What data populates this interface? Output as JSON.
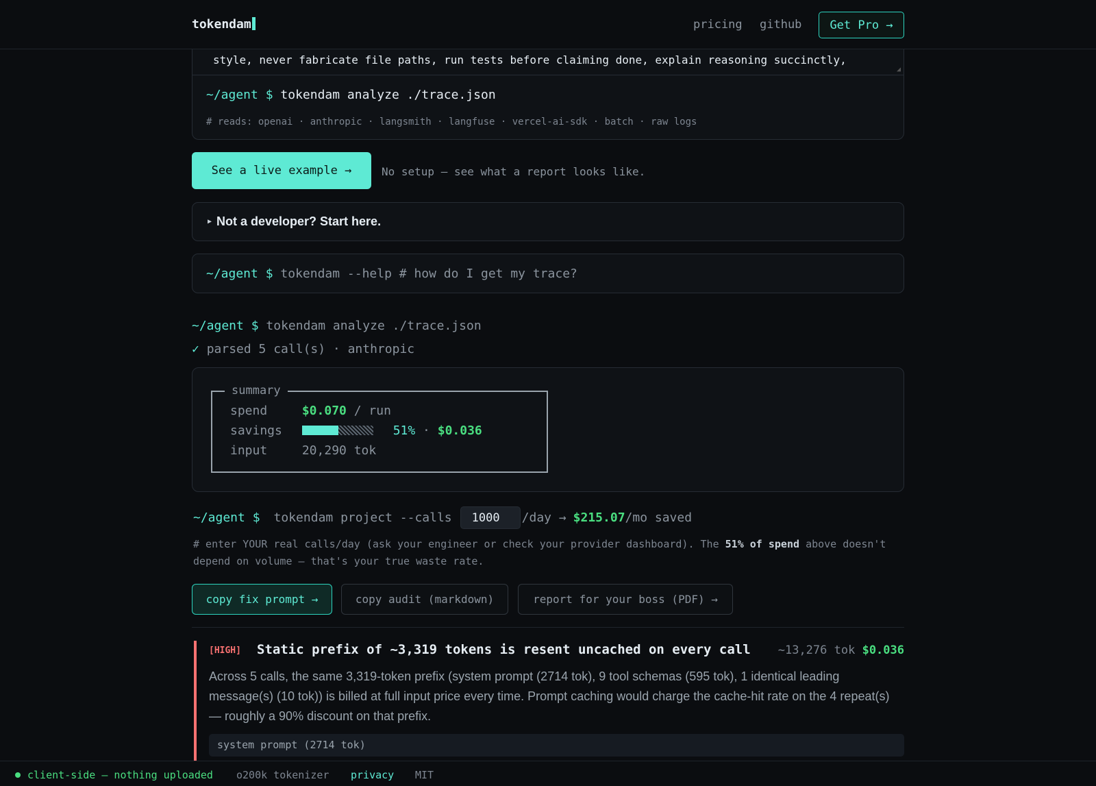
{
  "header": {
    "brand": "tokendam",
    "nav": [
      "pricing",
      "github"
    ],
    "cta": "Get Pro →"
  },
  "prompt_excerpt": "style, never fabricate file paths, run tests before claiming done, explain reasoning succinctly,",
  "analyze_box": {
    "prompt": "~/agent $",
    "command": "tokendam analyze ./trace.json",
    "reads": "# reads: openai · anthropic · langsmith · langfuse · vercel-ai-sdk · batch · raw logs"
  },
  "live": {
    "button": "See a live example →",
    "note": "No setup — see what a report looks like."
  },
  "not_developer": "Not a developer? Start here.",
  "help": {
    "prompt": "~/agent $",
    "command": "tokendam --help # how do I get my trace?"
  },
  "run": {
    "prompt": "~/agent $",
    "command": "tokendam analyze ./trace.json",
    "parsed_check": "✓",
    "parsed": "parsed 5 call(s) · anthropic"
  },
  "summary": {
    "title": "summary",
    "spend_label": "spend",
    "spend_value": "$0.070",
    "spend_unit": "/ run",
    "savings_label": "savings",
    "savings_fraction": 0.51,
    "savings_pct": "51%",
    "savings_sep": "·",
    "savings_value": "$0.036",
    "input_label": "input",
    "input_value": "20,290 tok"
  },
  "project": {
    "prompt": "~/agent $",
    "command": "tokendam project --calls",
    "calls": "1000",
    "per_day": "/day →",
    "saved_value": "$215.07",
    "saved_suffix": "/mo saved"
  },
  "note": {
    "before": "# enter YOUR real calls/day (ask your engineer or check your provider dashboard). The",
    "bold": "51% of spend",
    "after": "above doesn't depend on volume — that's your true waste rate."
  },
  "actions": [
    "copy fix prompt →",
    "copy audit (markdown)",
    "report for your boss (PDF) →"
  ],
  "finding": {
    "severity": "[HIGH]",
    "title": "Static prefix of ~3,319 tokens is resent uncached on every call",
    "tokens": "~13,276 tok",
    "cost": "$0.036",
    "body": "Across 5 calls, the same 3,319-token prefix (system prompt (2714 tok), 9 tool schemas (595 tok), 1 identical leading message(s) (10 tok)) is billed at full input price every time. Prompt caching would charge the cache-hit rate on the 4 repeat(s) — roughly a 90% discount on that prefix.",
    "chip": "system prompt (2714 tok)"
  },
  "footer": {
    "status": "client-side — nothing uploaded",
    "tokenizer": "o200k tokenizer",
    "privacy": "privacy",
    "license": "MIT"
  }
}
